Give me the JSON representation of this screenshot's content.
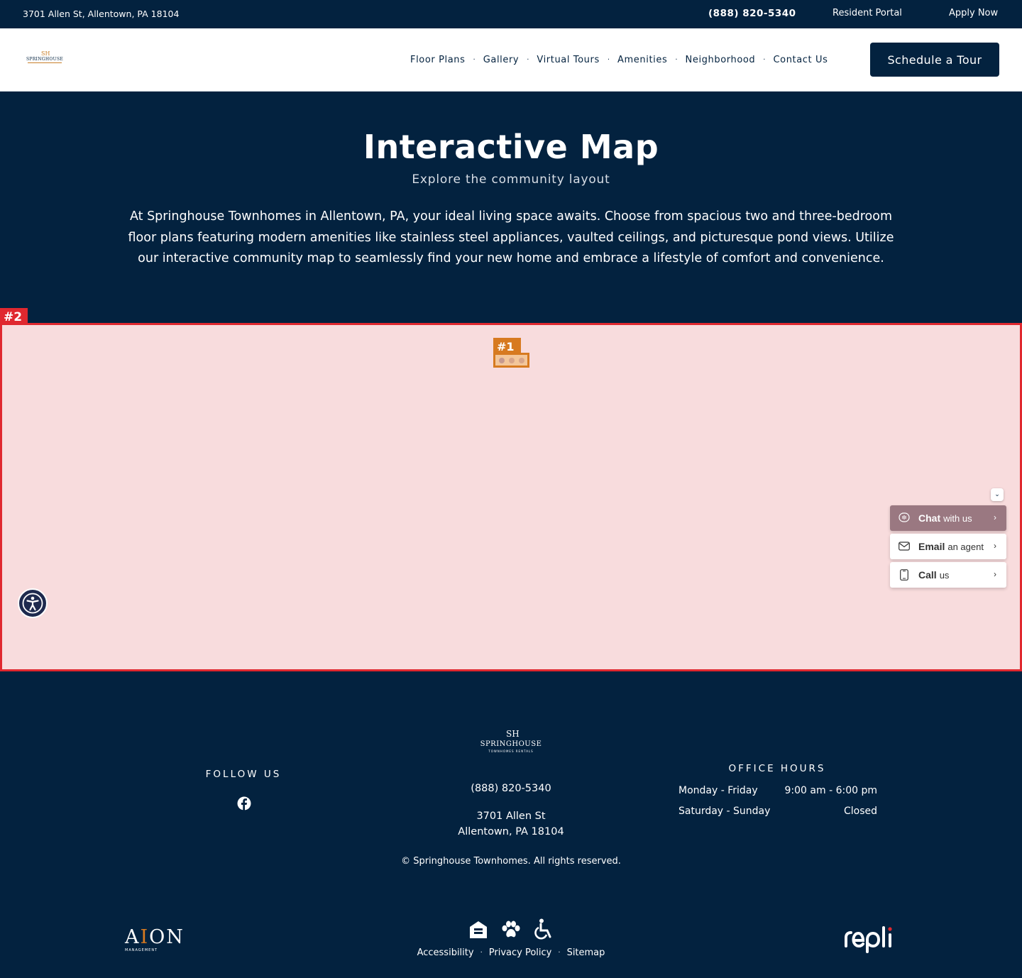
{
  "topbar": {
    "address": "3701 Allen St, Allentown, PA 18104",
    "phone": "(888) 820-5340",
    "resident_portal": "Resident Portal",
    "apply_now": "Apply Now"
  },
  "header": {
    "logo_mark": "SH",
    "logo_text": "SPRINGHOUSE",
    "nav": [
      "Floor Plans",
      "Gallery",
      "Virtual Tours",
      "Amenities",
      "Neighborhood",
      "Contact Us"
    ],
    "nav_separator": "·",
    "cta": "Schedule a Tour"
  },
  "hero": {
    "title": "Interactive Map",
    "subtitle": "Explore the community layout",
    "body": "At Springhouse Townhomes in Allentown, PA, your ideal living space awaits. Choose from spacious two and three-bedroom floor plans featuring modern amenities like stainless steel appliances, vaulted ceilings, and picturesque pond views. Utilize our interactive community map to seamlessly find your new home and embrace a lifestyle of comfort and convenience."
  },
  "map": {
    "region_label": "#2",
    "loader_label": "#1"
  },
  "widget": {
    "chat": {
      "bold": "Chat",
      "rest": "with us"
    },
    "email": {
      "bold": "Email",
      "rest": "an agent"
    },
    "call": {
      "bold": "Call",
      "rest": "us"
    },
    "chevron": "›",
    "collapse": "⌄"
  },
  "footer": {
    "follow_us": "FOLLOW US",
    "logo_text": "SPRINGHOUSE",
    "logo_sub": "TOWNHOMES RENTALS",
    "phone": "(888) 820-5340",
    "address_line1": "3701 Allen St",
    "address_line2": "Allentown, PA 18104",
    "copyright": "© Springhouse Townhomes. All rights reserved.",
    "office_hours_title": "OFFICE HOURS",
    "hours": [
      {
        "day": "Monday - Friday",
        "time": "9:00 am - 6:00 pm"
      },
      {
        "day": "Saturday - Sunday",
        "time": "Closed"
      }
    ],
    "links": [
      "Accessibility",
      "Privacy Policy",
      "Sitemap"
    ],
    "link_separator": "·",
    "aion": {
      "a": "A",
      "i": "I",
      "on": "ON",
      "mgmt": "MANAGEMENT"
    },
    "icons": [
      "equal-housing-icon",
      "paw-icon",
      "wheelchair-icon"
    ]
  },
  "colors": {
    "navy": "#03223f",
    "accent_orange": "#d77a20",
    "overlay_red": "#e0282f",
    "widget_chat_bg": "#9a7881"
  }
}
